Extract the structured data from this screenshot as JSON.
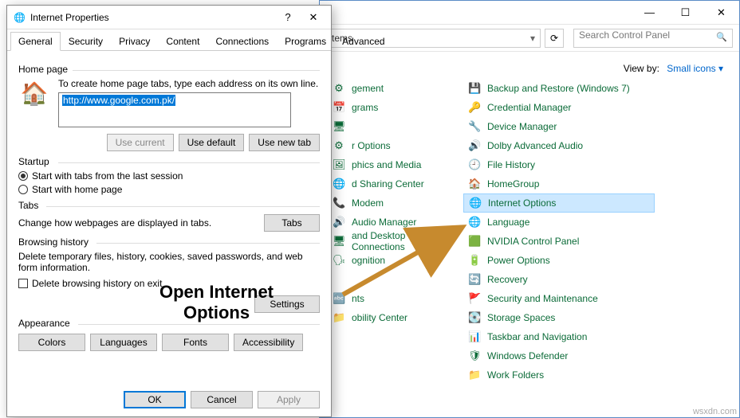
{
  "dialog": {
    "title": "Internet Properties",
    "tabs": [
      "General",
      "Security",
      "Privacy",
      "Content",
      "Connections",
      "Programs",
      "Advanced"
    ],
    "home": {
      "group": "Home page",
      "hint": "To create home page tabs, type each address on its own line.",
      "url": "http://www.google.com.pk/",
      "btn_current": "Use current",
      "btn_default": "Use default",
      "btn_newtab": "Use new tab"
    },
    "startup": {
      "group": "Startup",
      "opt_last": "Start with tabs from the last session",
      "opt_home": "Start with home page"
    },
    "tabsGroup": {
      "group": "Tabs",
      "hint": "Change how webpages are displayed in tabs.",
      "btn": "Tabs"
    },
    "history": {
      "group": "Browsing history",
      "hint": "Delete temporary files, history, cookies, saved passwords, and web form information.",
      "chk": "Delete browsing history on exit",
      "btn_settings": "Settings"
    },
    "appearance": {
      "group": "Appearance",
      "btn_colors": "Colors",
      "btn_lang": "Languages",
      "btn_fonts": "Fonts",
      "btn_access": "Accessibility"
    },
    "footer": {
      "ok": "OK",
      "cancel": "Cancel",
      "apply": "Apply"
    }
  },
  "cp": {
    "breadcrumb": "tems",
    "search_placeholder": "Search Control Panel",
    "viewby_label": "View by:",
    "viewby_value": "Small icons ▾",
    "left": [
      {
        "ico": "⚙",
        "t": "gement"
      },
      {
        "ico": "📅",
        "t": "grams"
      },
      {
        "ico": "🖥",
        "t": ""
      },
      {
        "ico": "⚙",
        "t": "r Options"
      },
      {
        "ico": "🖼",
        "t": "phics and Media"
      },
      {
        "ico": "🌐",
        "t": "d Sharing Center"
      },
      {
        "ico": "📞",
        "t": "Modem"
      },
      {
        "ico": "🔊",
        "t": "Audio Manager"
      },
      {
        "ico": "🖥",
        "t": "and Desktop Connections"
      },
      {
        "ico": "🗣",
        "t": "ognition"
      },
      {
        "ico": "",
        "t": ""
      },
      {
        "ico": "🔤",
        "t": "nts"
      },
      {
        "ico": "📁",
        "t": "obility Center"
      }
    ],
    "right": [
      {
        "ico": "💾",
        "t": "Backup and Restore (Windows 7)"
      },
      {
        "ico": "🔑",
        "t": "Credential Manager"
      },
      {
        "ico": "🔧",
        "t": "Device Manager"
      },
      {
        "ico": "🔊",
        "t": "Dolby Advanced Audio"
      },
      {
        "ico": "🕘",
        "t": "File History"
      },
      {
        "ico": "🏠",
        "t": "HomeGroup"
      },
      {
        "ico": "🌐",
        "t": "Internet Options"
      },
      {
        "ico": "🌐",
        "t": "Language"
      },
      {
        "ico": "🟩",
        "t": "NVIDIA Control Panel"
      },
      {
        "ico": "🔋",
        "t": "Power Options"
      },
      {
        "ico": "🔄",
        "t": "Recovery"
      },
      {
        "ico": "🚩",
        "t": "Security and Maintenance"
      },
      {
        "ico": "💽",
        "t": "Storage Spaces"
      },
      {
        "ico": "📊",
        "t": "Taskbar and Navigation"
      },
      {
        "ico": "🛡",
        "t": "Windows Defender"
      },
      {
        "ico": "📁",
        "t": "Work Folders"
      }
    ]
  },
  "annotation": "Open Internet\nOptions",
  "watermark": "wsxdn.com"
}
